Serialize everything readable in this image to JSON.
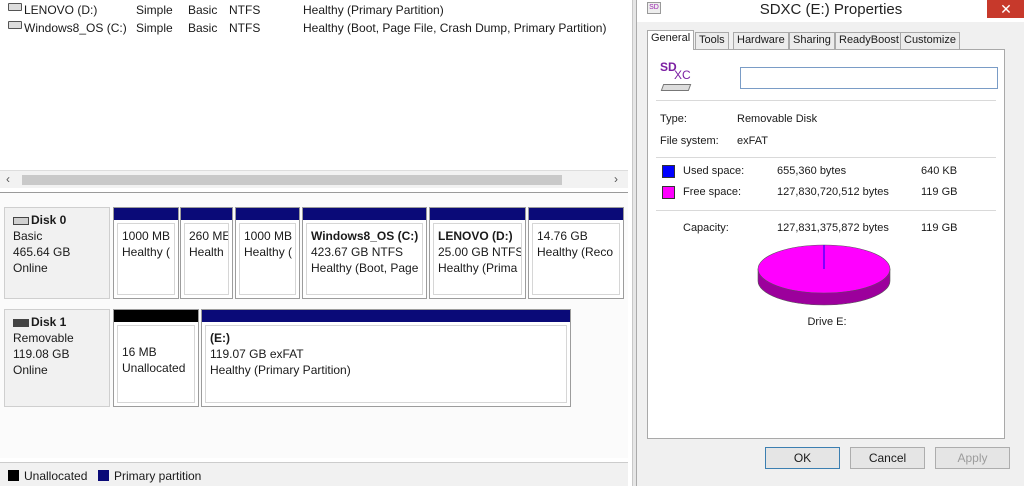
{
  "disk_management": {
    "volumes": [
      {
        "name": "LENOVO (D:)",
        "layout": "Simple",
        "type": "Basic",
        "fs": "NTFS",
        "status": "Healthy (Primary Partition)"
      },
      {
        "name": "Windows8_OS (C:)",
        "layout": "Simple",
        "type": "Basic",
        "fs": "NTFS",
        "status": "Healthy (Boot, Page File, Crash Dump, Primary Partition)"
      }
    ],
    "disks": [
      {
        "name": "Disk 0",
        "type": "Basic",
        "size": "465.64 GB",
        "state": "Online",
        "partitions": [
          {
            "title": "",
            "size": "1000 MB",
            "status": "Healthy (",
            "bar": "primary"
          },
          {
            "title": "",
            "size": "260 ME",
            "status": "Health",
            "bar": "primary"
          },
          {
            "title": "",
            "size": "1000 MB",
            "status": "Healthy (",
            "bar": "primary"
          },
          {
            "title": "Windows8_OS  (C:)",
            "size": "423.67 GB NTFS",
            "status": "Healthy (Boot, Page",
            "bar": "primary"
          },
          {
            "title": "LENOVO  (D:)",
            "size": "25.00 GB NTFS",
            "status": "Healthy (Prima",
            "bar": "primary"
          },
          {
            "title": "",
            "size": "14.76 GB",
            "status": "Healthy (Reco",
            "bar": "primary"
          }
        ]
      },
      {
        "name": "Disk 1",
        "type": "Removable",
        "size": "119.08 GB",
        "state": "Online",
        "partitions": [
          {
            "title": "",
            "size": "16 MB",
            "status": "Unallocated",
            "bar": "unallocated"
          },
          {
            "title": "(E:)",
            "size": "119.07 GB exFAT",
            "status": "Healthy (Primary Partition)",
            "bar": "primary"
          }
        ]
      }
    ],
    "legend": [
      {
        "label": "Unallocated",
        "color": "#000000"
      },
      {
        "label": "Primary partition",
        "color": "#0a0a78"
      }
    ]
  },
  "properties": {
    "title": "SDXC (E:) Properties",
    "close_glyph": "✕",
    "tabs": [
      "General",
      "Tools",
      "Hardware",
      "Sharing",
      "ReadyBoost",
      "Customize"
    ],
    "active_tab": "General",
    "icon_name": "sdxc-icon",
    "icon_text_sd": "SD",
    "icon_text_xc": "XC",
    "volume_label_value": "",
    "type_label": "Type:",
    "type_value": "Removable Disk",
    "fs_label": "File system:",
    "fs_value": "exFAT",
    "used_label": "Used space:",
    "used_bytes": "655,360 bytes",
    "used_size": "640 KB",
    "free_label": "Free space:",
    "free_bytes": "127,830,720,512 bytes",
    "free_size": "119 GB",
    "capacity_label": "Capacity:",
    "capacity_bytes": "127,831,375,872 bytes",
    "capacity_size": "119 GB",
    "drive_label": "Drive E:",
    "used_color": "#0000ff",
    "free_color": "#ff00ff",
    "free_fraction": 0.999995,
    "buttons": {
      "ok": "OK",
      "cancel": "Cancel",
      "apply": "Apply"
    }
  }
}
